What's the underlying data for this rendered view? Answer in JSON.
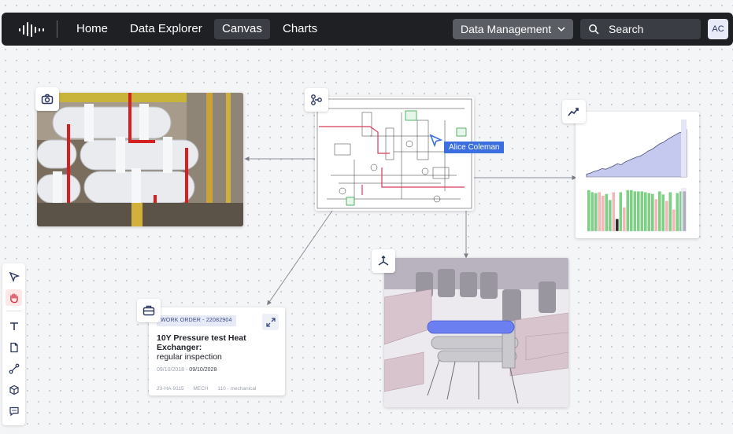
{
  "nav": {
    "items": [
      {
        "label": "Home",
        "active": false
      },
      {
        "label": "Data Explorer",
        "active": false
      },
      {
        "label": "Canvas",
        "active": true
      },
      {
        "label": "Charts",
        "active": false
      }
    ],
    "data_management_label": "Data Management",
    "search_label": "Search",
    "avatar_initials": "AC"
  },
  "canvas": {
    "cursor_user": "Alice Coleman",
    "work_order": {
      "tag": "WORK ORDER - 22082904",
      "title": "10Y Pressure test Heat Exchanger:",
      "subtitle": "regular inspection",
      "date_start": "09/10/2018",
      "date_separator": "-",
      "date_end": "09/10/2028",
      "meta": [
        "23-HA-9115",
        "MECH",
        "110 - mechanical"
      ]
    }
  },
  "toolbar": {
    "tools": [
      "select-icon",
      "hand-icon",
      "text-icon",
      "document-icon",
      "connector-icon",
      "cube-icon",
      "comment-icon"
    ],
    "active_tool": "hand-icon"
  },
  "colors": {
    "accent": "#3b6fe0",
    "topbar": "#1e2024",
    "pid_highlight": "#d93a5b",
    "bar_green": "#7fcf87",
    "bar_pink": "#f2b8b8"
  },
  "icons": {
    "photo_badge": "camera-icon",
    "pid_badge": "diagram-icon",
    "chart_badge": "trend-icon",
    "model_badge": "3d-axis-icon",
    "work_order_badge": "briefcase-icon",
    "expand": "expand-icon"
  },
  "chart_data": {
    "type": "bar",
    "bars": [
      {
        "value": 0.95,
        "color": "green"
      },
      {
        "value": 0.9,
        "color": "green"
      },
      {
        "value": 0.88,
        "color": "green"
      },
      {
        "value": 0.9,
        "color": "pink"
      },
      {
        "value": 0.82,
        "color": "pink"
      },
      {
        "value": 0.86,
        "color": "green"
      },
      {
        "value": 0.72,
        "color": "green"
      },
      {
        "value": 0.9,
        "color": "pink"
      },
      {
        "value": 0.28,
        "color": "dark"
      },
      {
        "value": 0.9,
        "color": "green"
      },
      {
        "value": 0.55,
        "color": "pink"
      },
      {
        "value": 0.95,
        "color": "green"
      },
      {
        "value": 0.95,
        "color": "green"
      },
      {
        "value": 0.92,
        "color": "green"
      },
      {
        "value": 0.92,
        "color": "green"
      },
      {
        "value": 0.92,
        "color": "green"
      },
      {
        "value": 0.9,
        "color": "green"
      },
      {
        "value": 0.88,
        "color": "green"
      },
      {
        "value": 0.86,
        "color": "green"
      },
      {
        "value": 0.74,
        "color": "pink"
      },
      {
        "value": 0.92,
        "color": "green"
      },
      {
        "value": 0.85,
        "color": "green"
      },
      {
        "value": 0.7,
        "color": "pink"
      },
      {
        "value": 0.9,
        "color": "green"
      },
      {
        "value": 0.5,
        "color": "pink"
      },
      {
        "value": 0.88,
        "color": "green"
      },
      {
        "value": 0.92,
        "color": "green"
      },
      {
        "value": 0.92,
        "color": "dark"
      }
    ],
    "area_values": [
      0.05,
      0.07,
      0.1,
      0.12,
      0.15,
      0.14,
      0.17,
      0.2,
      0.24,
      0.22,
      0.27,
      0.3,
      0.33,
      0.36,
      0.38,
      0.42,
      0.47,
      0.5,
      0.55,
      0.6,
      0.63,
      0.68,
      0.72,
      0.76,
      0.8,
      0.82,
      0.86
    ]
  }
}
